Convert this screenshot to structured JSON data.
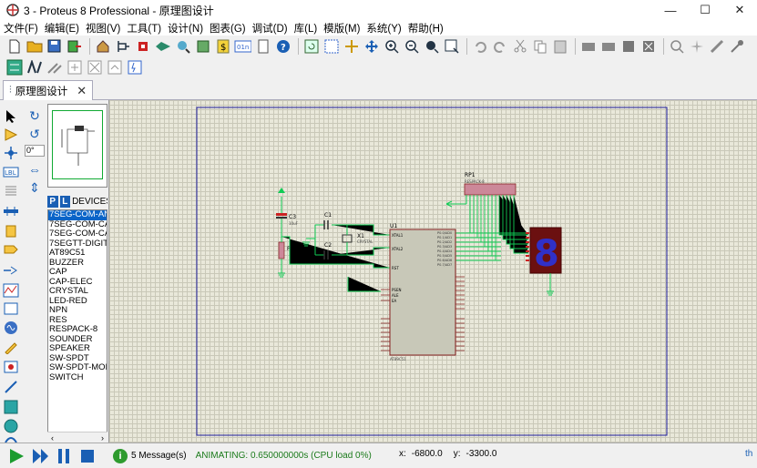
{
  "window": {
    "title": "3 - Proteus 8 Professional - 原理图设计",
    "minimize": "—",
    "maximize": "☐",
    "close": "✕"
  },
  "menu": [
    "文件(F)",
    "编辑(E)",
    "视图(V)",
    "工具(T)",
    "设计(N)",
    "图表(G)",
    "调试(D)",
    "库(L)",
    "模版(M)",
    "系统(Y)",
    "帮助(H)"
  ],
  "tab": {
    "label": "原理图设计",
    "close": "✕"
  },
  "rotation": {
    "angle": "0°"
  },
  "devices": {
    "p_label": "P",
    "l_label": "L",
    "header": "DEVICES",
    "items": [
      "7SEG-COM-AN",
      "7SEG-COM-CA",
      "7SEG-COM-CA",
      "7SEGTT-DIGIT",
      "AT89C51",
      "BUZZER",
      "CAP",
      "CAP-ELEC",
      "CRYSTAL",
      "LED-RED",
      "NPN",
      "RES",
      "RESPACK-8",
      "SOUNDER",
      "SPEAKER",
      "SW-SPDT",
      "SW-SPDT-MOM",
      "SWITCH"
    ],
    "selected_index": 0
  },
  "status": {
    "messages": "5 Message(s)",
    "animating": "ANIMATING: 0.650000000s (CPU load 0%)",
    "x_label": "x:",
    "x_value": "-6800.0",
    "y_label": "y:",
    "y_value": "-3300.0",
    "trailing": "th"
  },
  "schematic": {
    "rp1": "RP1",
    "rp1_type": "RESPACK-8",
    "u1": "U1",
    "u1_type": "AT89C51",
    "c1": "C1",
    "c2": "C2",
    "c3": "C3",
    "c3_val": "10uF",
    "x1": "X1",
    "x1_type": "CRYSTAL",
    "r1": "R1",
    "xtal1": "XTAL1",
    "xtal2": "XTAL2",
    "rst": "RST",
    "psen": "PSEN",
    "ale": "ALE",
    "ea": "EA",
    "display_digit": "8"
  }
}
